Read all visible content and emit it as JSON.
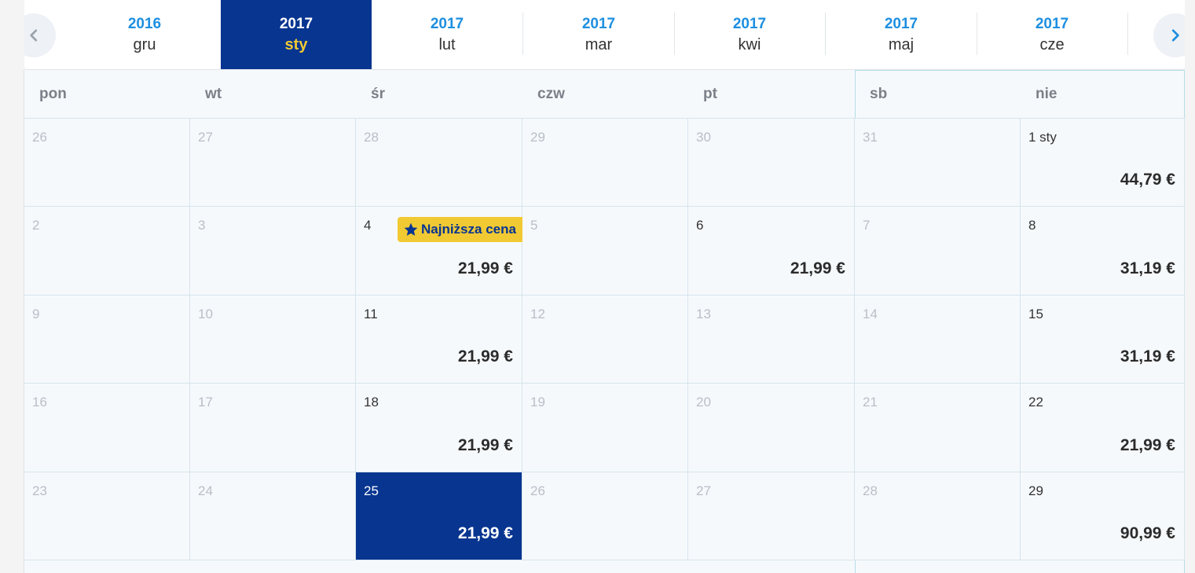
{
  "nav": {
    "prev_icon": "chevron-left-icon",
    "next_icon": "chevron-right-icon"
  },
  "months": [
    {
      "year": "2016",
      "month": "gru"
    },
    {
      "year": "2017",
      "month": "sty",
      "active": true
    },
    {
      "year": "2017",
      "month": "lut"
    },
    {
      "year": "2017",
      "month": "mar"
    },
    {
      "year": "2017",
      "month": "kwi"
    },
    {
      "year": "2017",
      "month": "maj"
    },
    {
      "year": "2017",
      "month": "cze"
    }
  ],
  "weekdays": [
    "pon",
    "wt",
    "śr",
    "czw",
    "pt",
    "sb",
    "nie"
  ],
  "badge": {
    "label": "Najniższa cena",
    "icon": "star-icon"
  },
  "colors": {
    "primary": "#073590",
    "accent_yellow": "#f1c933",
    "link_blue": "#1d8fe0"
  },
  "weeks": [
    [
      {
        "day": "26",
        "muted": true
      },
      {
        "day": "27",
        "muted": true
      },
      {
        "day": "28",
        "muted": true
      },
      {
        "day": "29",
        "muted": true
      },
      {
        "day": "30",
        "muted": true
      },
      {
        "day": "31",
        "muted": true
      },
      {
        "day": "1 sty",
        "price": "44,79 €"
      }
    ],
    [
      {
        "day": "2",
        "muted": true
      },
      {
        "day": "3",
        "muted": true
      },
      {
        "day": "4",
        "price": "21,99 €",
        "lowest": true
      },
      {
        "day": "5",
        "muted": true
      },
      {
        "day": "6",
        "price": "21,99 €"
      },
      {
        "day": "7",
        "muted": true
      },
      {
        "day": "8",
        "price": "31,19 €"
      }
    ],
    [
      {
        "day": "9",
        "muted": true
      },
      {
        "day": "10",
        "muted": true
      },
      {
        "day": "11",
        "price": "21,99 €"
      },
      {
        "day": "12",
        "muted": true
      },
      {
        "day": "13",
        "muted": true
      },
      {
        "day": "14",
        "muted": true
      },
      {
        "day": "15",
        "price": "31,19 €"
      }
    ],
    [
      {
        "day": "16",
        "muted": true
      },
      {
        "day": "17",
        "muted": true
      },
      {
        "day": "18",
        "price": "21,99 €"
      },
      {
        "day": "19",
        "muted": true
      },
      {
        "day": "20",
        "muted": true
      },
      {
        "day": "21",
        "muted": true
      },
      {
        "day": "22",
        "price": "21,99 €"
      }
    ],
    [
      {
        "day": "23",
        "muted": true
      },
      {
        "day": "24",
        "muted": true
      },
      {
        "day": "25",
        "price": "21,99 €",
        "selected": true
      },
      {
        "day": "26",
        "muted": true
      },
      {
        "day": "27",
        "muted": true
      },
      {
        "day": "28",
        "muted": true
      },
      {
        "day": "29",
        "price": "90,99 €"
      }
    ]
  ]
}
